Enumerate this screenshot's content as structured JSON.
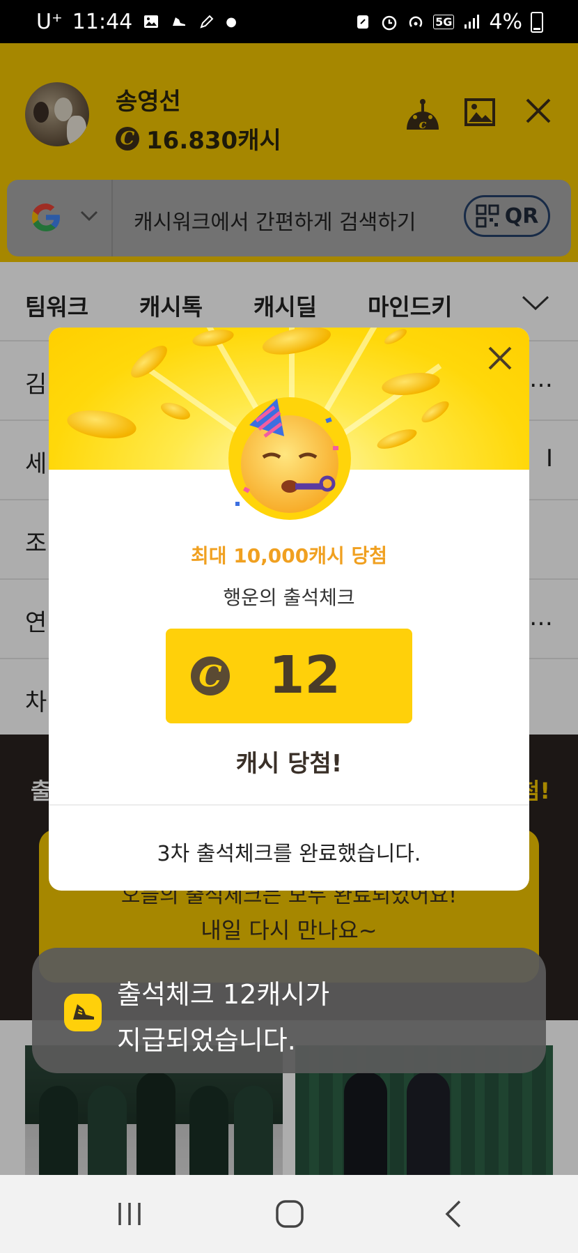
{
  "status_bar": {
    "carrier": "U⁺",
    "time": "11:44",
    "network": "5G",
    "battery": "4%"
  },
  "header": {
    "user_name": "송영선",
    "cash": "16.830캐시",
    "coin_symbol": "C",
    "icons": [
      "cash-bot-icon",
      "image-icon",
      "close-icon"
    ]
  },
  "search": {
    "engine_icon": "google-g-icon",
    "placeholder": "캐시워크에서 간편하게 검색하기",
    "qr_label": "QR"
  },
  "tabs": [
    "팀워크",
    "캐시톡",
    "캐시딜",
    "마인드키"
  ],
  "list_rows": [
    {
      "start": "김",
      "end": "…"
    },
    {
      "start": "세",
      "end": "I"
    },
    {
      "start": "조",
      "end": ""
    },
    {
      "start": "연",
      "end": "…"
    },
    {
      "start": "차",
      "end": ""
    }
  ],
  "dark_band": {
    "title_left": "출",
    "title_right": "첨!"
  },
  "promo_card": {
    "line1": "오늘의 출석체크는 모두 완료되었어요!",
    "line2": "내일 다시 만나요~"
  },
  "modal": {
    "headline": "최대 10,000캐시 당첨",
    "subtitle": "행운의 출석체크",
    "amount": "12",
    "coin_symbol": "C",
    "result": "캐시 당첨!",
    "footer": "3차 출석체크를 완료했습니다."
  },
  "toast": {
    "line1": "출석체크 12캐시가",
    "line2": "지급되었습니다."
  },
  "colors": {
    "brand_yellow": "#f5c700",
    "headline_orange": "#f0a020"
  }
}
